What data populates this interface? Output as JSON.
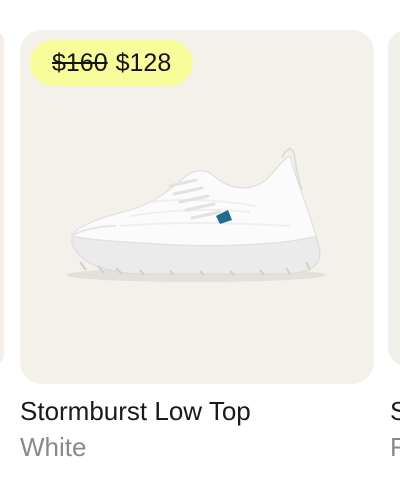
{
  "product": {
    "price_original": "$160",
    "price_sale": "$128",
    "name": "Stormburst Low Top",
    "color": "White",
    "image_icon": "sneaker-image"
  },
  "next_product": {
    "name_initial": "S",
    "color_initial": "F"
  },
  "colors": {
    "card_bg": "#f3f1ea",
    "badge_bg": "#f8fc9a",
    "accent_swatch": "#1e6d8a"
  }
}
